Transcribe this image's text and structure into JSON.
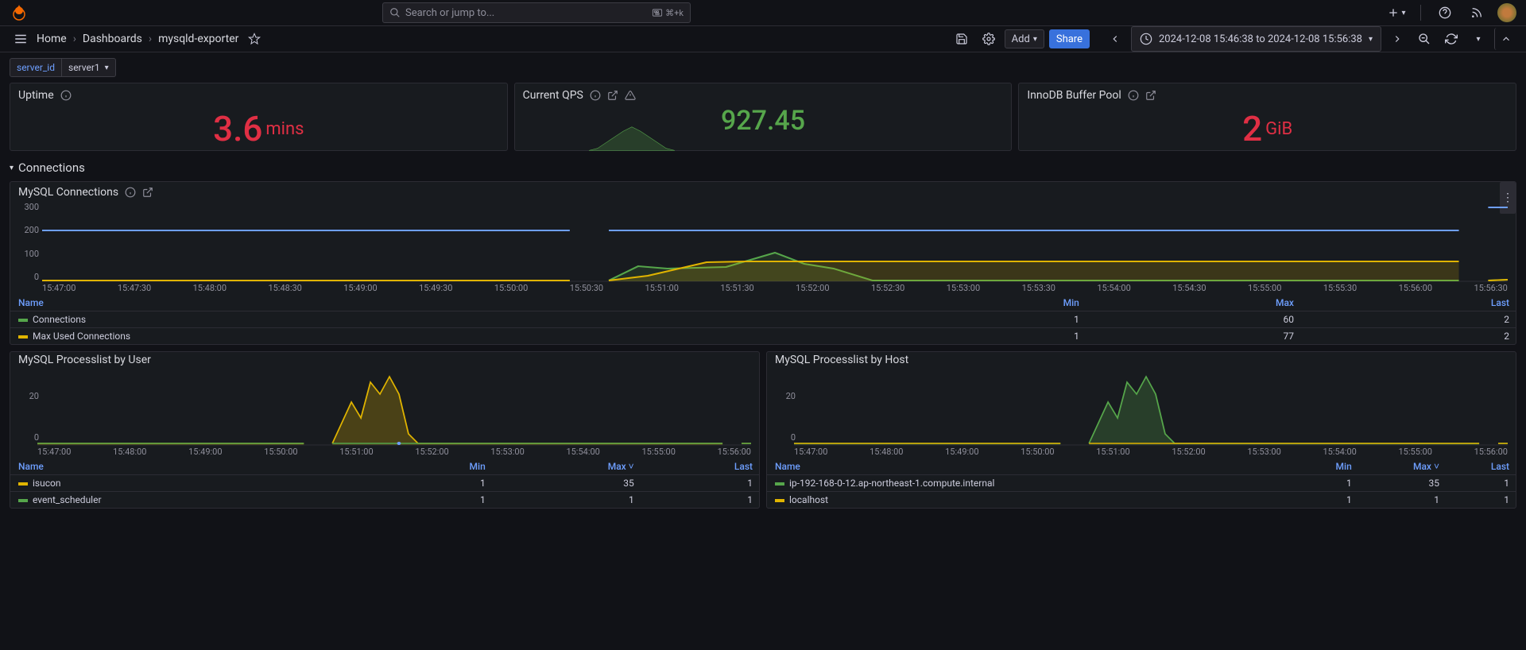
{
  "header": {
    "search_placeholder": "Search or jump to...",
    "shortcut": "⌘+k",
    "add_label": "Add"
  },
  "breadcrumb": {
    "home": "Home",
    "dashboards": "Dashboards",
    "current": "mysqld-exporter"
  },
  "toolbar": {
    "add_label": "Add",
    "share_label": "Share",
    "time_range": "2024-12-08 15:46:38 to 2024-12-08 15:56:38"
  },
  "variables": {
    "server_id_label": "server_id",
    "server_id_value": "server1"
  },
  "stats": {
    "uptime": {
      "title": "Uptime",
      "value": "3.6",
      "unit": "mins"
    },
    "qps": {
      "title": "Current QPS",
      "value": "927.45"
    },
    "innodb": {
      "title": "InnoDB Buffer Pool",
      "value": "2",
      "unit": "GiB"
    }
  },
  "row_connections_title": "Connections",
  "panel_mysql_connections": {
    "title": "MySQL Connections",
    "y_ticks": [
      "300",
      "200",
      "100",
      "0"
    ],
    "x_ticks": [
      "15:47:00",
      "15:47:30",
      "15:48:00",
      "15:48:30",
      "15:49:00",
      "15:49:30",
      "15:50:00",
      "15:50:30",
      "15:51:00",
      "15:51:30",
      "15:52:00",
      "15:52:30",
      "15:53:00",
      "15:53:30",
      "15:54:00",
      "15:54:30",
      "15:55:00",
      "15:55:30",
      "15:56:00",
      "15:56:30"
    ],
    "legend_headers": {
      "name": "Name",
      "min": "Min",
      "max": "Max",
      "last": "Last"
    },
    "series": [
      {
        "color": "#56a64b",
        "name": "Connections",
        "min": "1",
        "max": "60",
        "last": "2"
      },
      {
        "color": "#e0b400",
        "name": "Max Used Connections",
        "min": "1",
        "max": "77",
        "last": "2"
      }
    ]
  },
  "panel_processlist_user": {
    "title": "MySQL Processlist by User",
    "y_ticks": [
      "20",
      "0"
    ],
    "x_ticks": [
      "15:47:00",
      "15:48:00",
      "15:49:00",
      "15:50:00",
      "15:51:00",
      "15:52:00",
      "15:53:00",
      "15:54:00",
      "15:55:00",
      "15:56:00"
    ],
    "legend_headers": {
      "name": "Name",
      "min": "Min",
      "max": "Max ˅",
      "last": "Last"
    },
    "series": [
      {
        "color": "#e0b400",
        "name": "isucon",
        "min": "1",
        "max": "35",
        "last": "1"
      },
      {
        "color": "#56a64b",
        "name": "event_scheduler",
        "min": "1",
        "max": "1",
        "last": "1"
      }
    ]
  },
  "panel_processlist_host": {
    "title": "MySQL Processlist by Host",
    "y_ticks": [
      "20",
      "0"
    ],
    "x_ticks": [
      "15:47:00",
      "15:48:00",
      "15:49:00",
      "15:50:00",
      "15:51:00",
      "15:52:00",
      "15:53:00",
      "15:54:00",
      "15:55:00",
      "15:56:00"
    ],
    "legend_headers": {
      "name": "Name",
      "min": "Min",
      "max": "Max ˅",
      "last": "Last"
    },
    "series": [
      {
        "color": "#56a64b",
        "name": "ip-192-168-0-12.ap-northeast-1.compute.internal",
        "min": "1",
        "max": "35",
        "last": "1"
      },
      {
        "color": "#e0b400",
        "name": "localhost",
        "min": "1",
        "max": "1",
        "last": "1"
      }
    ]
  },
  "chart_data": [
    {
      "panel": "MySQL Connections",
      "type": "line",
      "xlabel": "",
      "ylabel": "",
      "ylim": [
        0,
        300
      ],
      "x_range": [
        "2024-12-08 15:46:38",
        "2024-12-08 15:56:38"
      ],
      "series": [
        {
          "name": "Connections",
          "color": "#56a64b",
          "values_approx": [
            1,
            1,
            1,
            1,
            1,
            1,
            1,
            null,
            1,
            60,
            50,
            20,
            1,
            1,
            1,
            1,
            1,
            1,
            1,
            1,
            null,
            2
          ]
        },
        {
          "name": "Max Used Connections",
          "color": "#e0b400",
          "values_approx": [
            1,
            1,
            1,
            1,
            1,
            1,
            1,
            null,
            1,
            20,
            60,
            77,
            77,
            77,
            77,
            77,
            77,
            77,
            77,
            77,
            null,
            2
          ]
        }
      ]
    },
    {
      "panel": "MySQL Processlist by User",
      "type": "area",
      "xlabel": "",
      "ylabel": "",
      "ylim": [
        0,
        40
      ],
      "x_range": [
        "2024-12-08 15:46:38",
        "2024-12-08 15:56:38"
      ],
      "series": [
        {
          "name": "isucon",
          "color": "#e0b400",
          "values_approx": [
            1,
            1,
            1,
            1,
            null,
            1,
            25,
            35,
            20,
            30,
            5,
            1,
            1,
            1,
            1,
            1,
            1,
            1,
            1
          ]
        },
        {
          "name": "event_scheduler",
          "color": "#56a64b",
          "values_approx": [
            1,
            1,
            1,
            1,
            null,
            1,
            1,
            1,
            1,
            1,
            1,
            1,
            1,
            1,
            1,
            1,
            1,
            1,
            1
          ]
        }
      ]
    },
    {
      "panel": "MySQL Processlist by Host",
      "type": "area",
      "xlabel": "",
      "ylabel": "",
      "ylim": [
        0,
        40
      ],
      "x_range": [
        "2024-12-08 15:46:38",
        "2024-12-08 15:56:38"
      ],
      "series": [
        {
          "name": "ip-192-168-0-12.ap-northeast-1.compute.internal",
          "color": "#56a64b",
          "values_approx": [
            1,
            1,
            1,
            1,
            null,
            1,
            25,
            35,
            20,
            30,
            5,
            1,
            1,
            1,
            1,
            1,
            1,
            1,
            1
          ]
        },
        {
          "name": "localhost",
          "color": "#e0b400",
          "values_approx": [
            1,
            1,
            1,
            1,
            null,
            1,
            1,
            1,
            1,
            1,
            1,
            1,
            1,
            1,
            1,
            1,
            1,
            1,
            1
          ]
        }
      ]
    }
  ]
}
